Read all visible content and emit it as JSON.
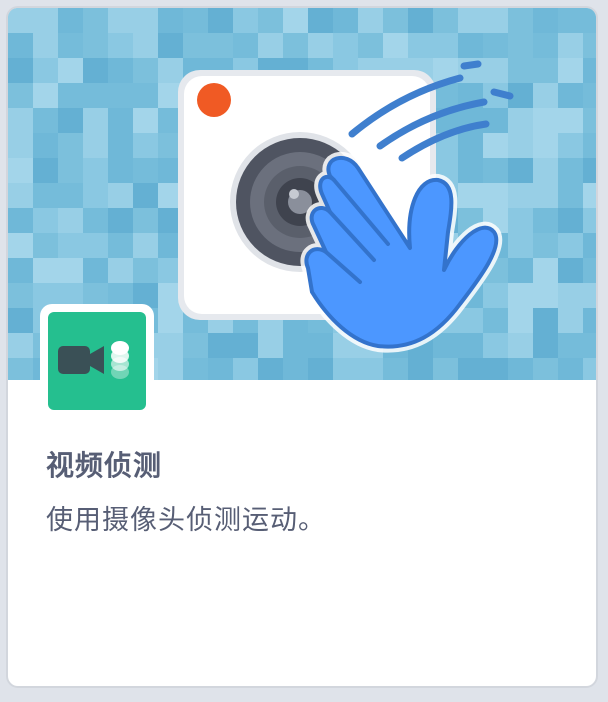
{
  "extension": {
    "title": "视频侦测",
    "description": "使用摄像头侦测运动。"
  },
  "icons": {
    "hero": "camera-waving-hand-icon",
    "badge": "video-camera-icon"
  },
  "colors": {
    "hero_background": "#7cc0dc",
    "badge_background": "#25bf8f",
    "hand": "#4c97ff",
    "text": "#575e75"
  }
}
